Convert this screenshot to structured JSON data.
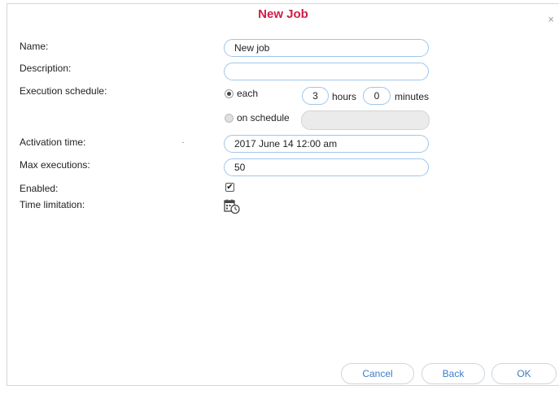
{
  "dialog": {
    "title": "New Job",
    "close_glyph": "×"
  },
  "form": {
    "name_label": "Name:",
    "name_value": "New job",
    "description_label": "Description:",
    "description_value": "",
    "schedule_label": "Execution schedule:",
    "each_label": "each",
    "each_selected": true,
    "hours_value": "3",
    "hours_label": "hours",
    "minutes_value": "0",
    "minutes_label": "minutes",
    "on_schedule_label": "on schedule",
    "on_schedule_selected": false,
    "on_schedule_value": "",
    "activation_label": "Activation time:",
    "activation_value": "2017 June 14 12:00 am",
    "max_exec_label": "Max executions:",
    "max_exec_value": "50",
    "enabled_label": "Enabled:",
    "enabled_checked": true,
    "enabled_glyph": "✔",
    "time_limit_label": "Time limitation:",
    "time_limit_icon": "calendar-clock-icon"
  },
  "buttons": {
    "cancel": "Cancel",
    "back": "Back",
    "ok": "OK"
  },
  "colors": {
    "title": "#d21b46",
    "input_border": "#9fc6ea",
    "button_text": "#3a7ec6"
  }
}
